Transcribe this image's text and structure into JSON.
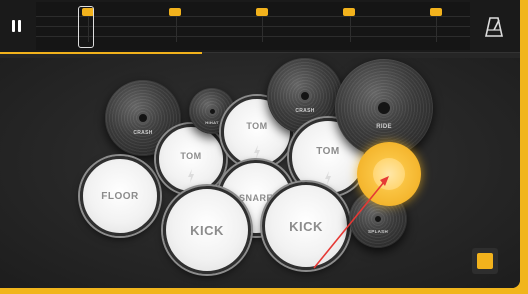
{
  "colors": {
    "accent": "#f2b21c",
    "annotation_arrow": "#e53935"
  },
  "toolbar": {
    "pause_icon": "pause-icon",
    "metronome_icon": "metronome-icon"
  },
  "pads": {
    "floor": "FLOOR",
    "tom_left": "TOM",
    "tom_center": "TOM",
    "tom_right": "TOM",
    "snare": "SNARE",
    "kick_left": "KICK",
    "kick_right": "KICK"
  },
  "cymbals": {
    "left": "CRASH",
    "small": "HIHAT",
    "top": "CRASH",
    "large": "RIDE",
    "lower": "SPLASH"
  },
  "record_icon": "record-icon"
}
